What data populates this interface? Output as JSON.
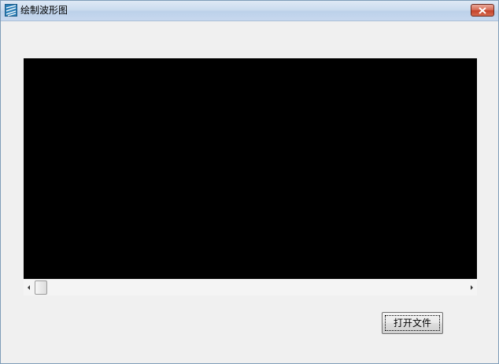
{
  "window": {
    "title": "绘制波形图",
    "close_icon": "close-icon",
    "app_icon": "waveform-app-icon"
  },
  "waveform_area": {
    "background_color": "#000000"
  },
  "scrollbar": {
    "left_arrow_icon": "arrow-left-icon",
    "right_arrow_icon": "arrow-right-icon",
    "position": 0
  },
  "buttons": {
    "open_file_label": "打开文件"
  }
}
